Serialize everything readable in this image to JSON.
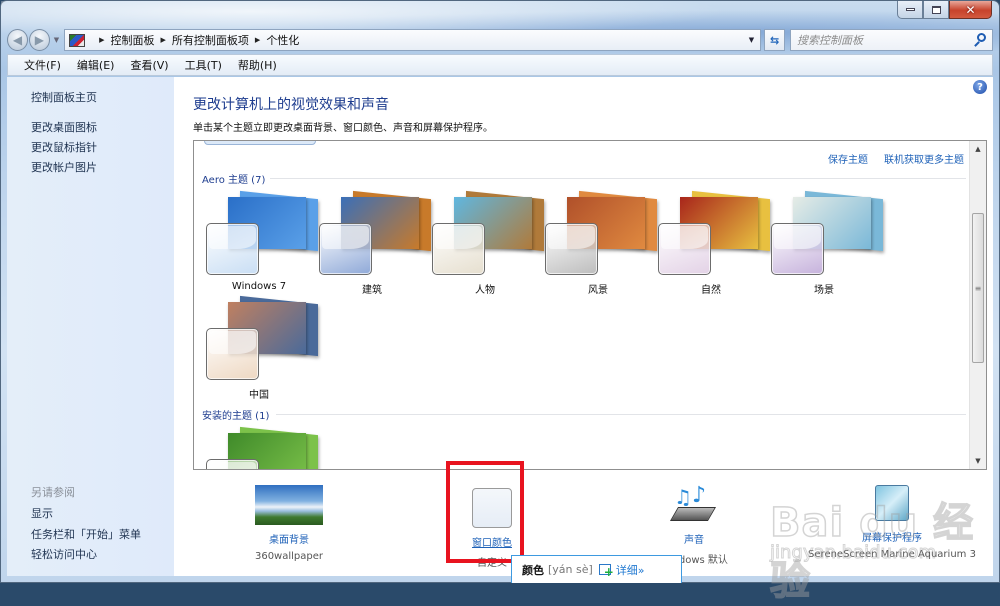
{
  "window": {
    "caption_buttons": [
      "minimize",
      "maximize",
      "close"
    ]
  },
  "navbar": {
    "breadcrumbs": [
      "控制面板",
      "所有控制面板项",
      "个性化"
    ],
    "search_placeholder": "搜索控制面板"
  },
  "menubar": {
    "items": [
      "文件(F)",
      "编辑(E)",
      "查看(V)",
      "工具(T)",
      "帮助(H)"
    ]
  },
  "sidebar": {
    "home": "控制面板主页",
    "links": [
      "更改桌面图标",
      "更改鼠标指针",
      "更改帐户图片"
    ],
    "see_also_heading": "另请参阅",
    "see_also": [
      "显示",
      "任务栏和「开始」菜单",
      "轻松访问中心"
    ]
  },
  "main": {
    "title": "更改计算机上的视觉效果和声音",
    "subtitle": "单击某个主题立即更改桌面背景、窗口颜色、声音和屏幕保护程序。",
    "pane_links": [
      "保存主题",
      "联机获取更多主题"
    ],
    "aero_group": "Aero 主题 (7)",
    "aero_themes": [
      {
        "name": "Windows 7",
        "photo": "#2a6fc8",
        "photo2": "#5aa0e8",
        "glass": "#c9def4"
      },
      {
        "name": "建筑",
        "photo": "#3a6fb8",
        "photo2": "#c87a2a",
        "glass": "#8fa9d8"
      },
      {
        "name": "人物",
        "photo": "#5fb7e0",
        "photo2": "#b07a3a",
        "glass": "#e6dfcf"
      },
      {
        "name": "风景",
        "photo": "#b0502a",
        "photo2": "#e08a40",
        "glass": "#bdbdbd"
      },
      {
        "name": "自然",
        "photo": "#a8251b",
        "photo2": "#e8c040",
        "glass": "#e3d2e6"
      },
      {
        "name": "场景",
        "photo": "#e6ece6",
        "photo2": "#7ab8d8",
        "glass": "#c6b2dc"
      },
      {
        "name": "中国",
        "photo": "#c08060",
        "photo2": "#4a6a9a",
        "glass": "#eed8c2"
      }
    ],
    "installed_group": "安装的主题 (1)",
    "installed_themes": [
      {
        "name": "",
        "photo": "#3f8a2a",
        "photo2": "#7cc24a",
        "glass": "#e8efe4"
      }
    ]
  },
  "bottom": {
    "items": [
      {
        "label": "桌面背景",
        "sub": "360wallpaper"
      },
      {
        "label": "窗口颜色",
        "sub": "自定义"
      },
      {
        "label": "声音",
        "sub": "Windows 默认"
      },
      {
        "label": "屏幕保护程序",
        "sub": "SereneScreen Marine Aquarium 3"
      }
    ]
  },
  "tooltip": {
    "word": "颜色",
    "pinyin": "[yán sè]",
    "detail": "详细»"
  },
  "watermark": {
    "text": "Bai du 经验",
    "url": "jingyan.baidu.com"
  }
}
